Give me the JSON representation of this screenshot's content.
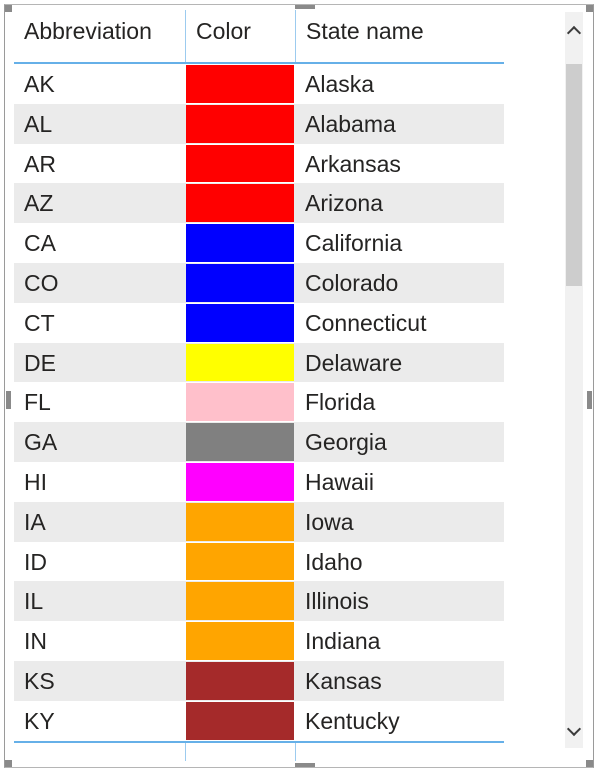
{
  "table": {
    "columns": [
      {
        "label": "Abbreviation"
      },
      {
        "label": "Color"
      },
      {
        "label": "State name"
      }
    ],
    "rows": [
      {
        "abbr": "AK",
        "color": "#FF0000",
        "state": "Alaska"
      },
      {
        "abbr": "AL",
        "color": "#FF0000",
        "state": "Alabama"
      },
      {
        "abbr": "AR",
        "color": "#FF0000",
        "state": "Arkansas"
      },
      {
        "abbr": "AZ",
        "color": "#FF0000",
        "state": "Arizona"
      },
      {
        "abbr": "CA",
        "color": "#0000FF",
        "state": "California"
      },
      {
        "abbr": "CO",
        "color": "#0000FF",
        "state": "Colorado"
      },
      {
        "abbr": "CT",
        "color": "#0000FF",
        "state": "Connecticut"
      },
      {
        "abbr": "DE",
        "color": "#FFFF00",
        "state": "Delaware"
      },
      {
        "abbr": "FL",
        "color": "#FFC0CB",
        "state": "Florida"
      },
      {
        "abbr": "GA",
        "color": "#808080",
        "state": "Georgia"
      },
      {
        "abbr": "HI",
        "color": "#FF00FF",
        "state": "Hawaii"
      },
      {
        "abbr": "IA",
        "color": "#FFA500",
        "state": "Iowa"
      },
      {
        "abbr": "ID",
        "color": "#FFA500",
        "state": "Idaho"
      },
      {
        "abbr": "IL",
        "color": "#FFA500",
        "state": "Illinois"
      },
      {
        "abbr": "IN",
        "color": "#FFA500",
        "state": "Indiana"
      },
      {
        "abbr": "KS",
        "color": "#A52A2A",
        "state": "Kansas"
      },
      {
        "abbr": "KY",
        "color": "#A52A2A",
        "state": "Kentucky"
      }
    ]
  },
  "scrollbar": {
    "up_icon": "chevron-up-icon",
    "down_icon": "chevron-down-icon",
    "scroll_position": 0.0
  },
  "colors": {
    "header_underline": "#66B0E8",
    "alt_row": "#EBEBEB"
  }
}
